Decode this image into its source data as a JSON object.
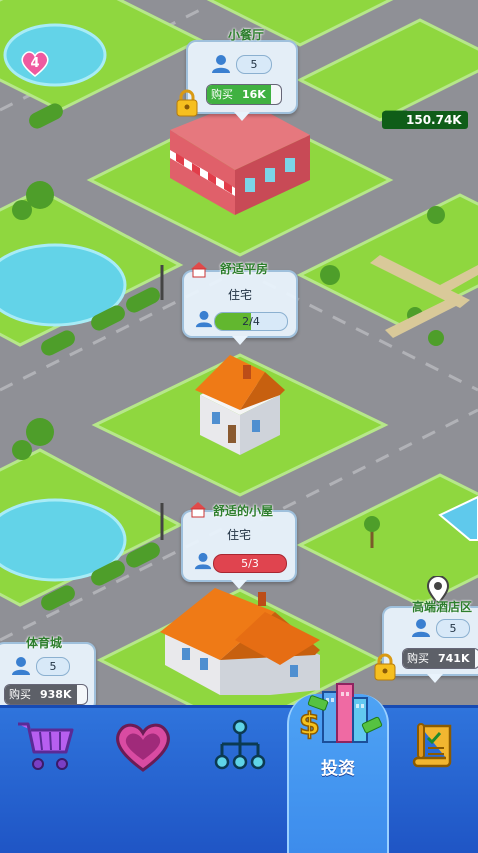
{
  "map": {
    "plots": {
      "restaurant": {
        "title": "小餐厅",
        "count": "5",
        "buy_label": "购买",
        "price": "16K",
        "locked": true
      },
      "apartment": {
        "title": "舒适平房",
        "type": "住宅",
        "occupancy": "2/4",
        "occupancy_fill": 0.5
      },
      "cottage": {
        "title": "舒适的小屋",
        "type": "住宅",
        "occupancy": "5/3",
        "occupancy_fill": 1.0
      },
      "stadium": {
        "title": "体育城",
        "count": "5",
        "buy_label": "购买",
        "price": "938K"
      },
      "right_building": {
        "title": "高端酒店区",
        "count": "5",
        "buy_label": "购买",
        "price": "741K",
        "locked": true
      }
    },
    "lake_badge": {
      "value": "4"
    },
    "money_tag": {
      "value": "150.74K"
    }
  },
  "nav": {
    "items": [
      {
        "icon": "shopping-cart-icon",
        "label": ""
      },
      {
        "icon": "heart-icon",
        "label": ""
      },
      {
        "icon": "network-icon",
        "label": ""
      },
      {
        "icon": "invest-icon",
        "label": "投资",
        "active": true
      },
      {
        "icon": "quest-scroll-icon",
        "label": ""
      }
    ]
  },
  "colors": {
    "grass": "#8fd73f",
    "road": "#8f9096",
    "water": "#63d3e8",
    "nav": "#2a67d6"
  }
}
